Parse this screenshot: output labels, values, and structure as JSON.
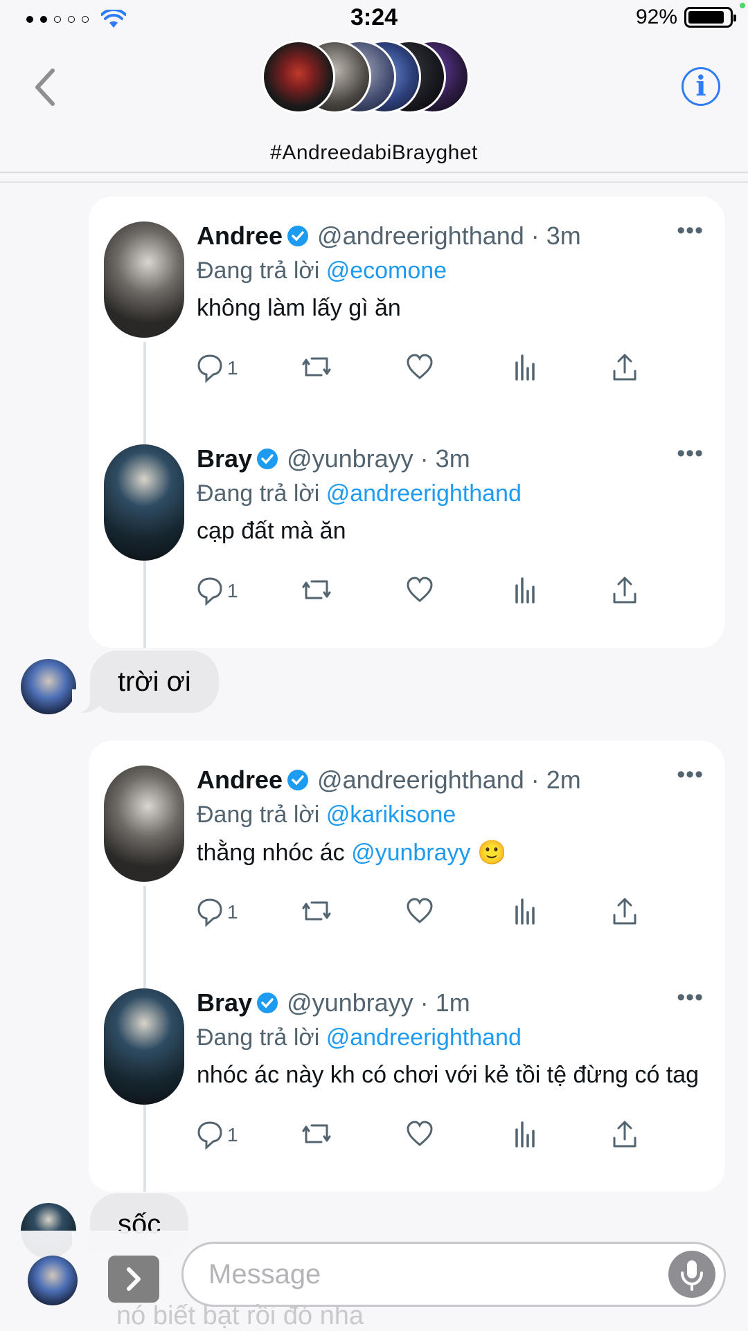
{
  "status_bar": {
    "time": "3:24",
    "battery": "92%",
    "signal_bars": 2,
    "signal_total": 5
  },
  "nav": {
    "title": "#AndreedabiBrayghet",
    "back_icon": "chevron-left-icon",
    "info_icon": "info-icon"
  },
  "colors": {
    "accent": "#2f7cf6",
    "twitter_blue": "#1d9bf0",
    "bubble_gray": "#e9e9eb"
  },
  "messages": [
    {
      "type": "tweet_card",
      "tweets": [
        {
          "name": "Andree",
          "handle": "@andreerighthand · 3m",
          "reply_prefix": "Đang trả lời ",
          "reply_to": "@ecomone",
          "text": "không làm lấy gì ăn",
          "text_mention": "",
          "emoji": "",
          "reply_count": "1"
        },
        {
          "name": "Bray",
          "handle": "@yunbrayy · 3m",
          "reply_prefix": "Đang trả lời ",
          "reply_to": "@andreerighthand",
          "text": "cạp đất mà ăn",
          "text_mention": "",
          "emoji": "",
          "reply_count": "1"
        }
      ]
    },
    {
      "type": "bubble",
      "text": "trời ơi"
    },
    {
      "type": "tweet_card",
      "tweets": [
        {
          "name": "Andree",
          "handle": "@andreerighthand · 2m",
          "reply_prefix": "Đang trả lời ",
          "reply_to": "@karikisone",
          "text": "thằng nhóc ác ",
          "text_mention": "@yunbrayy",
          "emoji": "🙂",
          "reply_count": "1"
        },
        {
          "name": "Bray",
          "handle": "@yunbrayy · 1m",
          "reply_prefix": "Đang trả lời ",
          "reply_to": "@andreerighthand",
          "text": "nhóc ác này kh có chơi với kẻ tồi tệ đừng có tag",
          "text_mention": "",
          "emoji": "",
          "reply_count": "1"
        }
      ]
    },
    {
      "type": "bubble",
      "text": "sốc"
    }
  ],
  "input": {
    "placeholder": "Message",
    "mic_icon": "microphone-icon",
    "expand_icon": "chevron-right-icon"
  },
  "partial_text_below": "nó biết bạt rồi đó nha"
}
